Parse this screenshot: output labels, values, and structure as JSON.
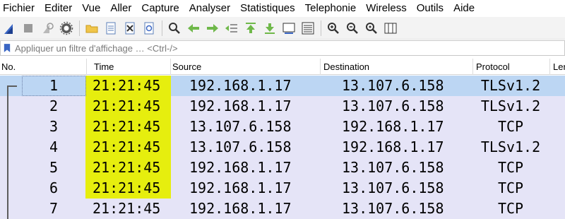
{
  "menu": {
    "items": [
      "Fichier",
      "Editer",
      "Vue",
      "Aller",
      "Capture",
      "Analyser",
      "Statistiques",
      "Telephonie",
      "Wireless",
      "Outils",
      "Aide"
    ]
  },
  "toolbar": {
    "icons": [
      "shark-fin-icon",
      "stop-icon",
      "restart-icon",
      "options-gear-icon",
      "open-folder-icon",
      "save-file-icon",
      "close-file-icon",
      "reload-icon",
      "find-icon",
      "back-arrow-icon",
      "forward-arrow-icon",
      "goto-packet-icon",
      "first-packet-icon",
      "last-packet-icon",
      "autoscroll-icon",
      "colorize-icon",
      "zoom-in-icon",
      "zoom-out-icon",
      "zoom-normal-icon",
      "resize-columns-icon"
    ]
  },
  "filter": {
    "placeholder": "Appliquer un filtre d'affichage … <Ctrl-/>"
  },
  "columns": {
    "no": "No.",
    "time": "Time",
    "source": "Source",
    "destination": "Destination",
    "protocol": "Protocol",
    "length": "Ler"
  },
  "packets": [
    {
      "no": "1",
      "time": "21:21:45",
      "source": "192.168.1.17",
      "destination": "13.107.6.158",
      "protocol": "TLSv1.2"
    },
    {
      "no": "2",
      "time": "21:21:45",
      "source": "192.168.1.17",
      "destination": "13.107.6.158",
      "protocol": "TLSv1.2"
    },
    {
      "no": "3",
      "time": "21:21:45",
      "source": "13.107.6.158",
      "destination": "192.168.1.17",
      "protocol": "TCP"
    },
    {
      "no": "4",
      "time": "21:21:45",
      "source": "13.107.6.158",
      "destination": "192.168.1.17",
      "protocol": "TLSv1.2"
    },
    {
      "no": "5",
      "time": "21:21:45",
      "source": "192.168.1.17",
      "destination": "13.107.6.158",
      "protocol": "TCP"
    },
    {
      "no": "6",
      "time": "21:21:45",
      "source": "192.168.1.17",
      "destination": "13.107.6.158",
      "protocol": "TCP"
    },
    {
      "no": "7",
      "time": "21:21:45",
      "source": "192.168.1.17",
      "destination": "13.107.6.158",
      "protocol": "TCP"
    }
  ],
  "colors": {
    "tcp_row": "#e5e4f7",
    "selected_row": "#bcd6f3",
    "time_highlight": "#e6ee0e"
  }
}
